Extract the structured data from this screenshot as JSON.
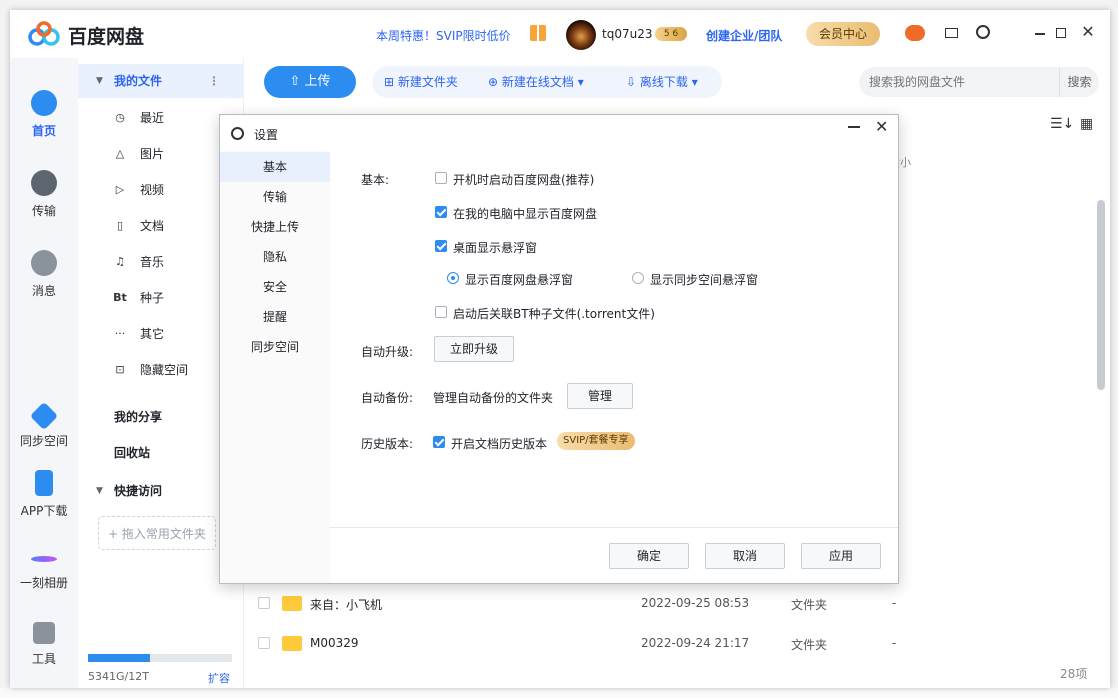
{
  "app": {
    "name": "百度网盘",
    "promo": "本周特惠！SVIP限时低价",
    "username": "tq07u23",
    "level": "5 6",
    "enterprise": "创建企业/团队",
    "member_center": "会员中心"
  },
  "leftnav": {
    "items": [
      {
        "label": "首页"
      },
      {
        "label": "传输"
      },
      {
        "label": "消息"
      },
      {
        "label": "同步空间"
      },
      {
        "label": "APP下载"
      },
      {
        "label": "一刻相册"
      },
      {
        "label": "工具"
      }
    ]
  },
  "sidebar": {
    "my_files": "我的文件",
    "items": [
      "最近",
      "图片",
      "视频",
      "文档",
      "音乐",
      "种子",
      "其它",
      "隐藏空间"
    ],
    "my_share": "我的分享",
    "recycle": "回收站",
    "quick_access": "快捷访问",
    "drag_hint": "+ 拖入常用文件夹",
    "quota": "5341G/12T",
    "expand": "扩容"
  },
  "toolbar": {
    "upload": "上传",
    "new_folder": "新建文件夹",
    "new_doc": "新建在线文档",
    "offline": "离线下载",
    "search_placeholder": "搜索我的网盘文件",
    "search_btn": "搜索"
  },
  "files": {
    "col_size": "大小",
    "rows": [
      {
        "name": "来自：小飞机",
        "date": "2022-09-25 08:53",
        "type": "文件夹",
        "size": "-"
      },
      {
        "name": "M00329",
        "date": "2022-09-24 21:17",
        "type": "文件夹",
        "size": "-"
      }
    ],
    "count": "28项"
  },
  "dialog": {
    "title": "设置",
    "nav": [
      "基本",
      "传输",
      "快捷上传",
      "隐私",
      "安全",
      "提醒",
      "同步空间"
    ],
    "basic_label": "基本:",
    "opt_startup": "开机时启动百度网盘(推荐)",
    "opt_show_in_pc": "在我的电脑中显示百度网盘",
    "opt_float": "桌面显示悬浮窗",
    "radio_baidu_float": "显示百度网盘悬浮窗",
    "radio_sync_float": "显示同步空间悬浮窗",
    "opt_bt": "启动后关联BT种子文件(.torrent文件)",
    "upgrade_label": "自动升级:",
    "upgrade_btn": "立即升级",
    "backup_label": "自动备份:",
    "backup_text": "管理自动备份的文件夹",
    "backup_btn": "管理",
    "history_label": "历史版本:",
    "history_opt": "开启文档历史版本",
    "svip_tag": "SVIP/套餐专享",
    "ok": "确定",
    "cancel": "取消",
    "apply": "应用"
  }
}
